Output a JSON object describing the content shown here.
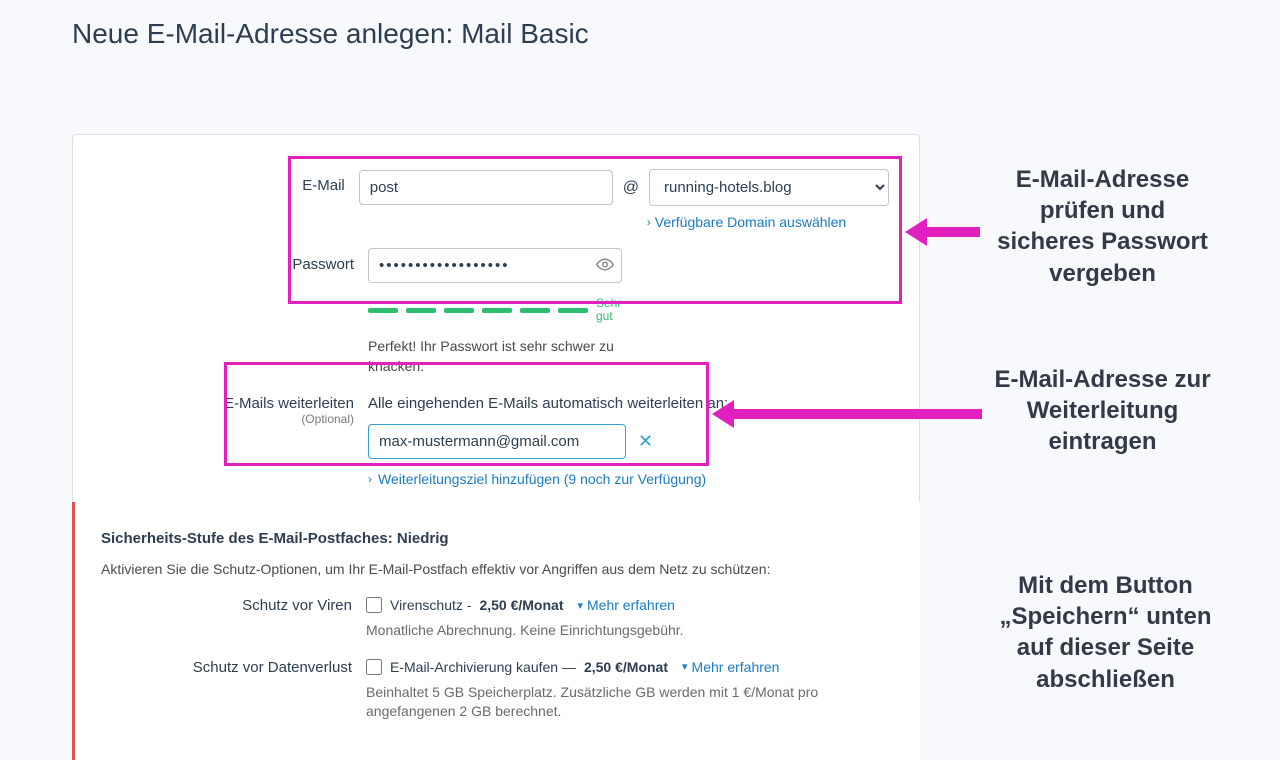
{
  "page": {
    "title": "Neue E-Mail-Adresse anlegen: Mail Basic"
  },
  "form": {
    "email_label": "E-Mail",
    "email_local_value": "post",
    "at": "@",
    "domain_selected": "running-hotels.blog",
    "domain_link": "Verfügbare Domain auswählen",
    "password_label": "Passwort",
    "password_value": "••••••••••••••••••",
    "strength_label": "Sehr gut",
    "password_help": "Perfekt! Ihr Passwort ist sehr schwer zu knacken.",
    "forward_label": "E-Mails weiterleiten",
    "forward_optional": "(Optional)",
    "forward_desc": "Alle eingehenden E-Mails automatisch weiterleiten an:",
    "forward_value": "max-mustermann@gmail.com",
    "forward_add": "Weiterleitungsziel hinzufügen (9 noch zur Verfügung)"
  },
  "callouts": {
    "c1": "E-Mail-Adresse\nprüfen und sicheres Passwort vergeben",
    "c2": "E-Mail-Adresse zur Weiterleitung eintragen",
    "c3": "Mit dem Button „Speichern“ unten auf dieser Seite abschließen"
  },
  "security": {
    "title": "Sicherheits-Stufe des E-Mail-Postfaches: Niedrig",
    "desc": "Aktivieren Sie die Schutz-Optionen, um Ihr E-Mail-Postfach effektiv vor Angriffen aus dem Netz zu schützen:",
    "virus_label": "Schutz vor Viren",
    "virus_text_a": "Virenschutz - ",
    "virus_text_b": "2,50 €/Monat",
    "virus_sub": "Monatliche Abrechnung. Keine Einrichtungsgebühr.",
    "loss_label": "Schutz vor Datenverlust",
    "loss_text_a": "E-Mail-Archivierung kaufen — ",
    "loss_text_b": "2,50 €/Monat",
    "loss_sub": "Beinhaltet 5 GB Speicherplatz. Zusätzliche GB werden mit 1 €/Monat pro angefangenen 2 GB berechnet.",
    "learn_more": "Mehr erfahren"
  }
}
